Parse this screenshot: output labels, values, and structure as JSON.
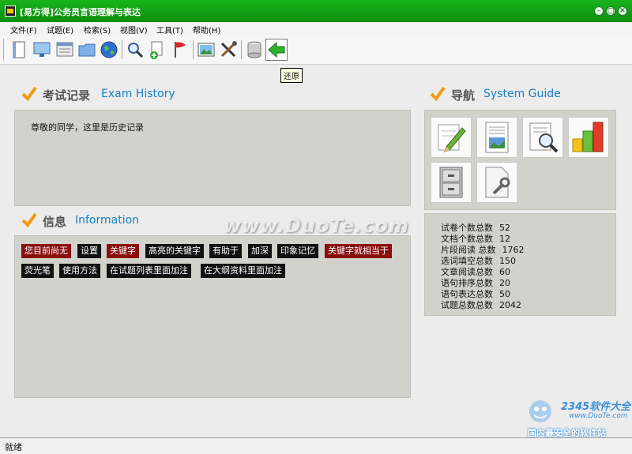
{
  "window": {
    "title": "[易方得]公务员言语理解与表达",
    "minimize": "–",
    "maximize": "□",
    "close": "✕"
  },
  "menu": [
    "文件(F)",
    "试题(E)",
    "检索(S)",
    "视图(V)",
    "工具(T)",
    "帮助(H)"
  ],
  "toolbar": {
    "buttons": [
      "document-icon",
      "monitor-icon",
      "list-icon",
      "folder-icon",
      "globe-icon",
      "search-icon",
      "add-document-icon",
      "flag-icon",
      "image-icon",
      "tools-icon",
      "database-icon",
      "back-arrow-icon"
    ],
    "tooltip": "还原"
  },
  "history": {
    "title_cn": "考试记录",
    "title_en": "Exam History",
    "text": "尊敬的同学，这里是历史记录"
  },
  "info": {
    "title_cn": "信息",
    "title_en": "Information",
    "tags": [
      {
        "text": "您目前尚无",
        "style": "red"
      },
      {
        "text": "设置",
        "style": "dark"
      },
      {
        "text": "关键字",
        "style": "red"
      },
      {
        "text": "高亮的关键字",
        "style": "dark"
      },
      {
        "text": "有助于",
        "style": "dark"
      },
      {
        "text": "加深",
        "style": "dark"
      },
      {
        "text": "印象记忆",
        "style": "dark"
      },
      {
        "text": "关键字就相当于",
        "style": "red"
      },
      {
        "text": "荧光笔",
        "style": "dark"
      },
      {
        "text": "使用方法",
        "style": "dark"
      },
      {
        "text": "在试题列表里面加注",
        "style": "dark"
      },
      {
        "text": "在大纲资料里面加注",
        "style": "dark"
      }
    ]
  },
  "guide": {
    "title_cn": "导航",
    "title_en": "System Guide",
    "tiles": [
      "pencil-notepad-icon",
      "document-image-icon",
      "magnifier-document-icon",
      "bar-chart-icon",
      "filing-cabinet-icon",
      "document-wrench-icon"
    ]
  },
  "stats": [
    {
      "label": "试卷个数总数",
      "value": "52"
    },
    {
      "label": "文档个数总数",
      "value": "12"
    },
    {
      "label": "片段阅读 总数",
      "value": "1762"
    },
    {
      "label": "选词填空总数",
      "value": "150"
    },
    {
      "label": "文章阅读总数",
      "value": "60"
    },
    {
      "label": "语句排序总数",
      "value": "20"
    },
    {
      "label": "语句表达总数",
      "value": "50"
    },
    {
      "label": "试题总数总数",
      "value": "2042"
    }
  ],
  "watermarks": {
    "duote": "www.DuoTe.com",
    "brand": "2345软件大全",
    "brand_url": "www.DuoTe.com",
    "brand_slogan": "国内最安全的软件站"
  },
  "status": {
    "text": "就绪"
  },
  "colors": {
    "titlebar": "#0a8d0e",
    "accent_blue": "#1580c5",
    "check_orange": "#f29a10",
    "tag_red": "#8b0e0e",
    "tag_dark": "#111111"
  }
}
